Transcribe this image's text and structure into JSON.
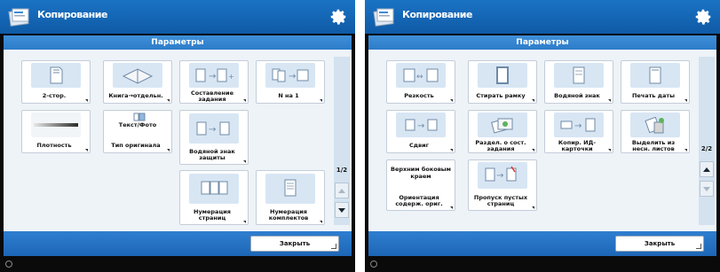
{
  "app": {
    "title": "Копирование",
    "subtitle": "Параметры",
    "close_label": "Закрыть"
  },
  "left": {
    "page_indicator": "1/2",
    "tiles": [
      {
        "label": "2-стор.",
        "icon": "duplex-page-icon"
      },
      {
        "label": "Книга→отдельн.",
        "icon": "book-scan-icon"
      },
      {
        "label": "Составление задания",
        "icon": "job-build-icon"
      },
      {
        "label": "N на 1",
        "icon": "n-on-1-icon"
      },
      {
        "label": "Плотность",
        "icon": "density-slider-icon"
      },
      {
        "label": "Тип оригинала",
        "icon": "original-type-icon",
        "top_label": "Текст/Фото"
      },
      {
        "label": "Водяной знак защиты",
        "icon": "secure-watermark-icon"
      },
      {
        "label": "Нумерация страниц",
        "icon": "page-numbering-icon"
      },
      {
        "label": "Нумерация комплектов",
        "icon": "set-numbering-icon"
      }
    ]
  },
  "right": {
    "page_indicator": "2/2",
    "tiles": [
      {
        "label": "Резкость",
        "icon": "sharpness-icon"
      },
      {
        "label": "Стирать рамку",
        "icon": "erase-frame-icon"
      },
      {
        "label": "Водяной знак",
        "icon": "watermark-icon"
      },
      {
        "label": "Печать даты",
        "icon": "print-date-icon"
      },
      {
        "label": "Сдвиг",
        "icon": "shift-icon"
      },
      {
        "label": "Раздел. о сост. задания",
        "icon": "job-separator-icon"
      },
      {
        "label": "Копир. ИД-карточки",
        "icon": "id-card-copy-icon"
      },
      {
        "label": "Выделить из несн. листов",
        "icon": "different-size-originals-icon"
      },
      {
        "label": "Ориентация содерж. ориг.",
        "icon": "content-orientation-icon",
        "top_label": "Верхним боковым краем"
      },
      {
        "label": "Пропуск пустых страниц",
        "icon": "skip-blank-pages-icon"
      }
    ]
  }
}
